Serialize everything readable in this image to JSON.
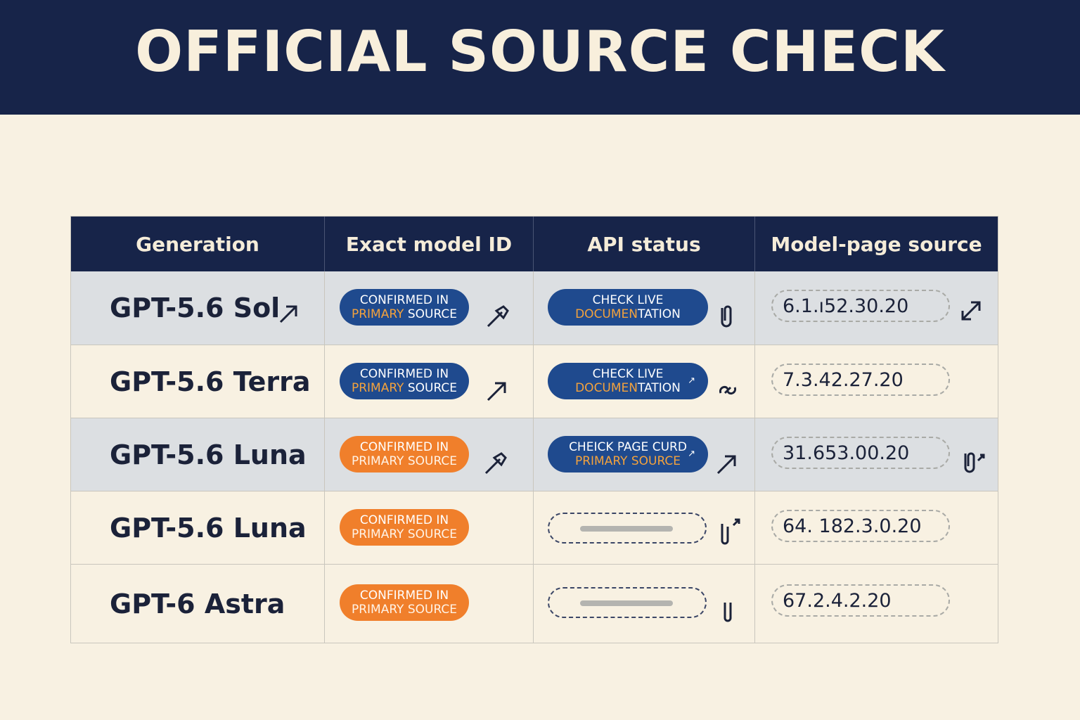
{
  "header": {
    "title": "OFFICIAL SOURCE CHECK"
  },
  "columns": [
    "Generation",
    "Exact model ID",
    "API status",
    "Model-page source"
  ],
  "rows": [
    {
      "generation": "GPT-5.6 Sol",
      "model_id": {
        "line1": "CONFIRMED IN",
        "line2": "PRIMARY SOURCE",
        "color": "#1f4a8e"
      },
      "api_status": {
        "type": "pill",
        "line1": "CHECK LIVE",
        "line2a": "DOCUMEN",
        "line2b": "TATION",
        "color": "#1f4a8e"
      },
      "source": "6.1.ı52.30.20",
      "icons": {
        "gen": "arrow-up-right-icon",
        "model": "pin-arrow-icon",
        "api": "clip-icon",
        "source": "expand-icon"
      }
    },
    {
      "generation": "GPT-5.6 Terra",
      "model_id": {
        "line1": "CONFIRMED IN",
        "line2": "PRIMARY SOURCE",
        "color": "#1f4a8e"
      },
      "api_status": {
        "type": "pill",
        "line1": "CHECK LIVE",
        "line2a": "DOCUMEN",
        "line2b": "TATION",
        "color": "#1f4a8e"
      },
      "source": "7.3.42.27.20",
      "icons": {
        "model": "arrow-up-right-icon",
        "api": "link-icon"
      }
    },
    {
      "generation": "GPT-5.6 Luna",
      "model_id": {
        "line1": "CONFIRMED IN",
        "line2": "PRIMARY SOURCE",
        "color": "#f07f2b"
      },
      "api_status": {
        "type": "pill",
        "line1": "CHEICK PAGE CURD",
        "line2a": "PRIMARY SOURCE",
        "line2b": "",
        "color": "#1f4a8e"
      },
      "source": "31.653.00.20",
      "icons": {
        "model": "pin-arrow-icon",
        "api": "arrow-up-right-icon",
        "source": "clip-arrow-icon"
      }
    },
    {
      "generation": "GPT-5.6 Luna",
      "model_id": {
        "line1": "CONFIRMED IN",
        "line2": "PRIMARY SOURCE",
        "color": "#f07f2b"
      },
      "api_status": {
        "type": "placeholder"
      },
      "source": "64. 182.3.0.20",
      "icons": {
        "api": "clip-arrow-icon"
      }
    },
    {
      "generation": "GPT-6 Astra",
      "model_id": {
        "line1": "CONFIRMED IN",
        "line2": "PRIMARY SOURCE",
        "color": "#f07f2b"
      },
      "api_status": {
        "type": "placeholder"
      },
      "source": "67.2.4.2.20",
      "icons": {
        "api": "clip-icon"
      }
    }
  ]
}
